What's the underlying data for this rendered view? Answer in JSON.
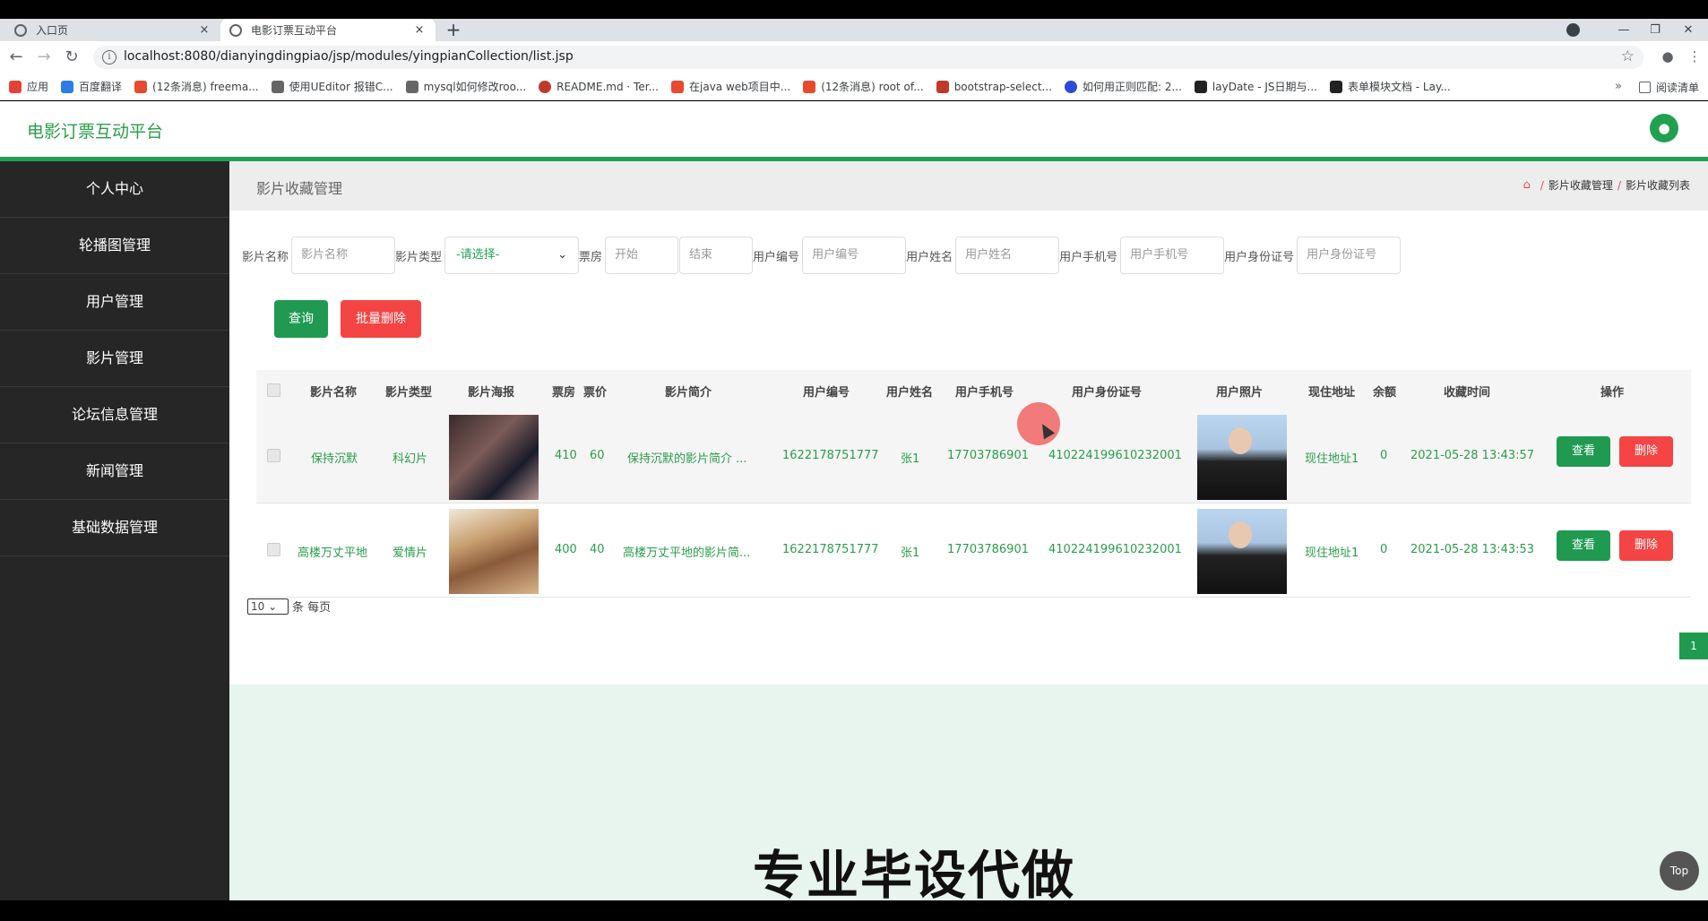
{
  "browser": {
    "tabs": [
      {
        "title": "入口页",
        "close": "×"
      },
      {
        "title": "电影订票互动平台",
        "close": "×"
      }
    ],
    "new_tab": "+",
    "url": "localhost:8080/dianyingdingpiao/jsp/modules/yingpianCollection/list.jsp",
    "bookmarks": [
      {
        "label": "应用",
        "color": "#e34234"
      },
      {
        "label": "百度翻译",
        "color": "#2d7be5"
      },
      {
        "label": "(12条消息) freema...",
        "color": "#e84a2f"
      },
      {
        "label": "使用UEditor 报错C...",
        "color": "#666666"
      },
      {
        "label": "mysql如何修改roo...",
        "color": "#666666"
      },
      {
        "label": "README.md · Ter...",
        "color": "#c0392b"
      },
      {
        "label": "在java web项目中...",
        "color": "#e84a2f"
      },
      {
        "label": "(12条消息) root of...",
        "color": "#e84a2f"
      },
      {
        "label": "bootstrap-select...",
        "color": "#c0392b"
      },
      {
        "label": "如何用正则匹配: 2...",
        "color": "#2d4bd8"
      },
      {
        "label": "layDate - JS日期与...",
        "color": "#222222"
      },
      {
        "label": "表单模块文档 - Lay...",
        "color": "#222222"
      }
    ],
    "more": "»",
    "reading_list": "阅读清单"
  },
  "app": {
    "title": "电影订票互动平台",
    "avatar_icon": "user-icon"
  },
  "sidebar": {
    "items": [
      {
        "label": "个人中心"
      },
      {
        "label": "轮播图管理"
      },
      {
        "label": "用户管理"
      },
      {
        "label": "影片管理"
      },
      {
        "label": "论坛信息管理"
      },
      {
        "label": "新闻管理"
      },
      {
        "label": "基础数据管理"
      }
    ]
  },
  "page": {
    "title": "影片收藏管理",
    "breadcrumb": [
      "影片收藏管理",
      "影片收藏列表"
    ]
  },
  "filters": {
    "movie_name_label": "影片名称",
    "movie_name_placeholder": "影片名称",
    "movie_type_label": "影片类型",
    "movie_type_value": "-请选择-",
    "box_office_label": "票房",
    "box_office_start_placeholder": "开始",
    "box_office_end_placeholder": "结束",
    "user_no_label": "用户编号",
    "user_no_placeholder": "用户编号",
    "user_name_label": "用户姓名",
    "user_name_placeholder": "用户姓名",
    "user_phone_label": "用户手机号",
    "user_phone_placeholder": "用户手机号",
    "user_id_label": "用户身份证号",
    "user_id_placeholder": "用户身份证号"
  },
  "actions": {
    "query": "查询",
    "batch_delete": "批量删除"
  },
  "table": {
    "headers": {
      "name": "影片名称",
      "type": "影片类型",
      "poster": "影片海报",
      "box": "票房",
      "price": "票价",
      "intro": "影片简介",
      "user_no": "用户编号",
      "user_name": "用户姓名",
      "phone": "用户手机号",
      "idcard": "用户身份证号",
      "photo": "用户照片",
      "address": "现住地址",
      "balance": "余额",
      "time": "收藏时间",
      "ops": "操作"
    },
    "rows": [
      {
        "name": "保持沉默",
        "type": "科幻片",
        "box": "410",
        "price": "60",
        "intro": "保持沉默的影片简介 ...",
        "user_no": "1622178751777",
        "user_name": "张1",
        "phone": "17703786901",
        "idcard": "410224199610232001",
        "address": "现住地址1",
        "balance": "0",
        "time": "2021-05-28 13:43:57",
        "view": "查看",
        "delete": "删除"
      },
      {
        "name": "高楼万丈平地",
        "type": "爱情片",
        "box": "400",
        "price": "40",
        "intro": "高楼万丈平地的影片简...",
        "user_no": "1622178751777",
        "user_name": "张1",
        "phone": "17703786901",
        "idcard": "410224199610232001",
        "address": "现住地址1",
        "balance": "0",
        "time": "2021-05-28 13:43:53",
        "view": "查看",
        "delete": "删除"
      }
    ]
  },
  "pagination": {
    "page_size": "10",
    "page_size_suffix": "条 每页",
    "current_page": "1"
  },
  "overlay": {
    "watermark": "专业毕设代做",
    "top_button": "Top"
  }
}
